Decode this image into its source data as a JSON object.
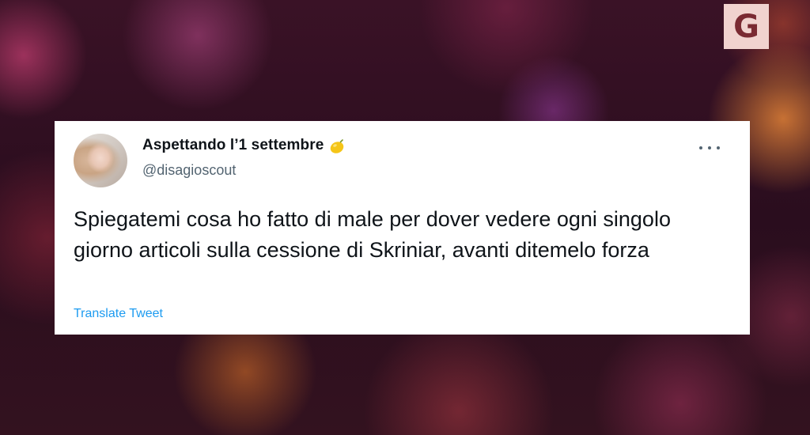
{
  "brand": {
    "letter": "G",
    "bg_color": "#f1d3cf",
    "fg_color": "#7a2a32"
  },
  "tweet": {
    "author": {
      "display_name": "Aspettando l’1 settembre",
      "emoji_icon": "lemon-icon",
      "handle": "@disagioscout"
    },
    "text": "Spiegatemi cosa ho fatto di male per dover vedere ogni singolo giorno articoli sulla cessione di Skriniar, avanti ditemelo forza",
    "translate_label": "Translate Tweet",
    "more_icon": "more-options-icon"
  },
  "colors": {
    "text": "#0f1419",
    "secondary": "#536471",
    "link": "#1d9bf0"
  }
}
